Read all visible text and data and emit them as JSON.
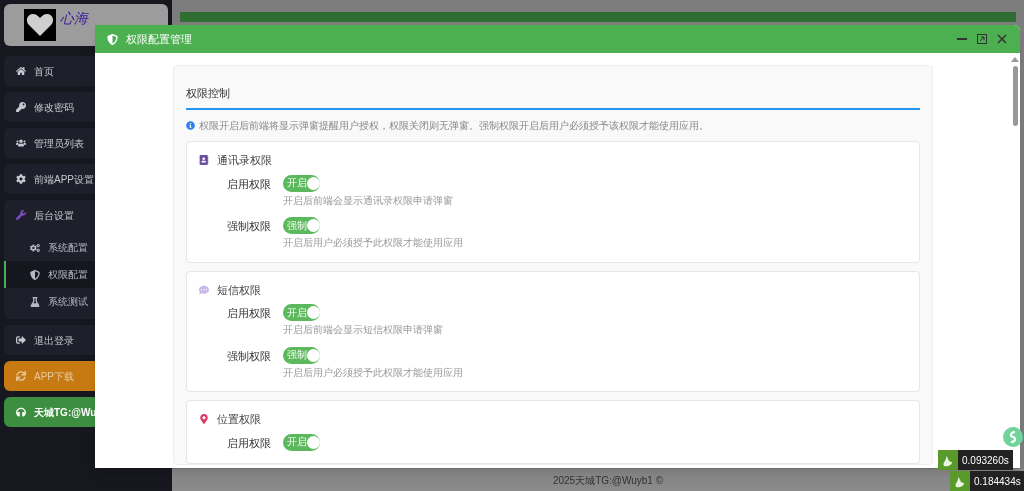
{
  "sidebar": {
    "logo_text": "心海",
    "items": [
      {
        "kind": "link",
        "label": "首页",
        "selected": false
      },
      {
        "kind": "link",
        "label": "修改密码",
        "selected": false
      },
      {
        "kind": "link",
        "label": "管理员列表",
        "selected": false
      },
      {
        "kind": "link",
        "label": "前端APP设置",
        "selected": false
      },
      {
        "kind": "link",
        "label": "后台设置",
        "selected": false,
        "children": [
          {
            "label": "系统配置",
            "selected": false
          },
          {
            "label": "权限配置",
            "selected": true
          },
          {
            "label": "系统测试",
            "selected": false
          }
        ]
      },
      {
        "kind": "link",
        "label": "退出登录",
        "selected": false
      },
      {
        "kind": "orange",
        "label": "APP下载",
        "selected": false
      },
      {
        "kind": "green",
        "label": "天城TG:@Wu",
        "selected": false
      }
    ]
  },
  "footer": "2025天城TG:@Wuyb1 ©",
  "modal": {
    "title": "权限配置管理",
    "section_title": "权限控制",
    "notice": "权限开启后前端将显示弹窗提醒用户授权，权限关闭则无弹窗。强制权限开启后用户必须授予该权限才能使用应用。",
    "groups": [
      {
        "title": "通讯录权限",
        "settings": [
          {
            "label": "启用权限",
            "on": true,
            "switch_text": "开启",
            "hint": "开启后前端会显示通讯录权限申请弹窗"
          },
          {
            "label": "强制权限",
            "on": true,
            "switch_text": "强制",
            "hint": "开启后用户必须授予此权限才能使用应用"
          }
        ]
      },
      {
        "title": "短信权限",
        "settings": [
          {
            "label": "启用权限",
            "on": true,
            "switch_text": "开启",
            "hint": "开启后前端会显示短信权限申请弹窗"
          },
          {
            "label": "强制权限",
            "on": true,
            "switch_text": "强制",
            "hint": "开启后用户必须授予此权限才能使用应用"
          }
        ]
      },
      {
        "title": "位置权限",
        "settings": [
          {
            "label": "启用权限",
            "on": true,
            "switch_text": "开启"
          }
        ]
      }
    ]
  },
  "timers": [
    "0.093260s",
    "0.184434s"
  ]
}
